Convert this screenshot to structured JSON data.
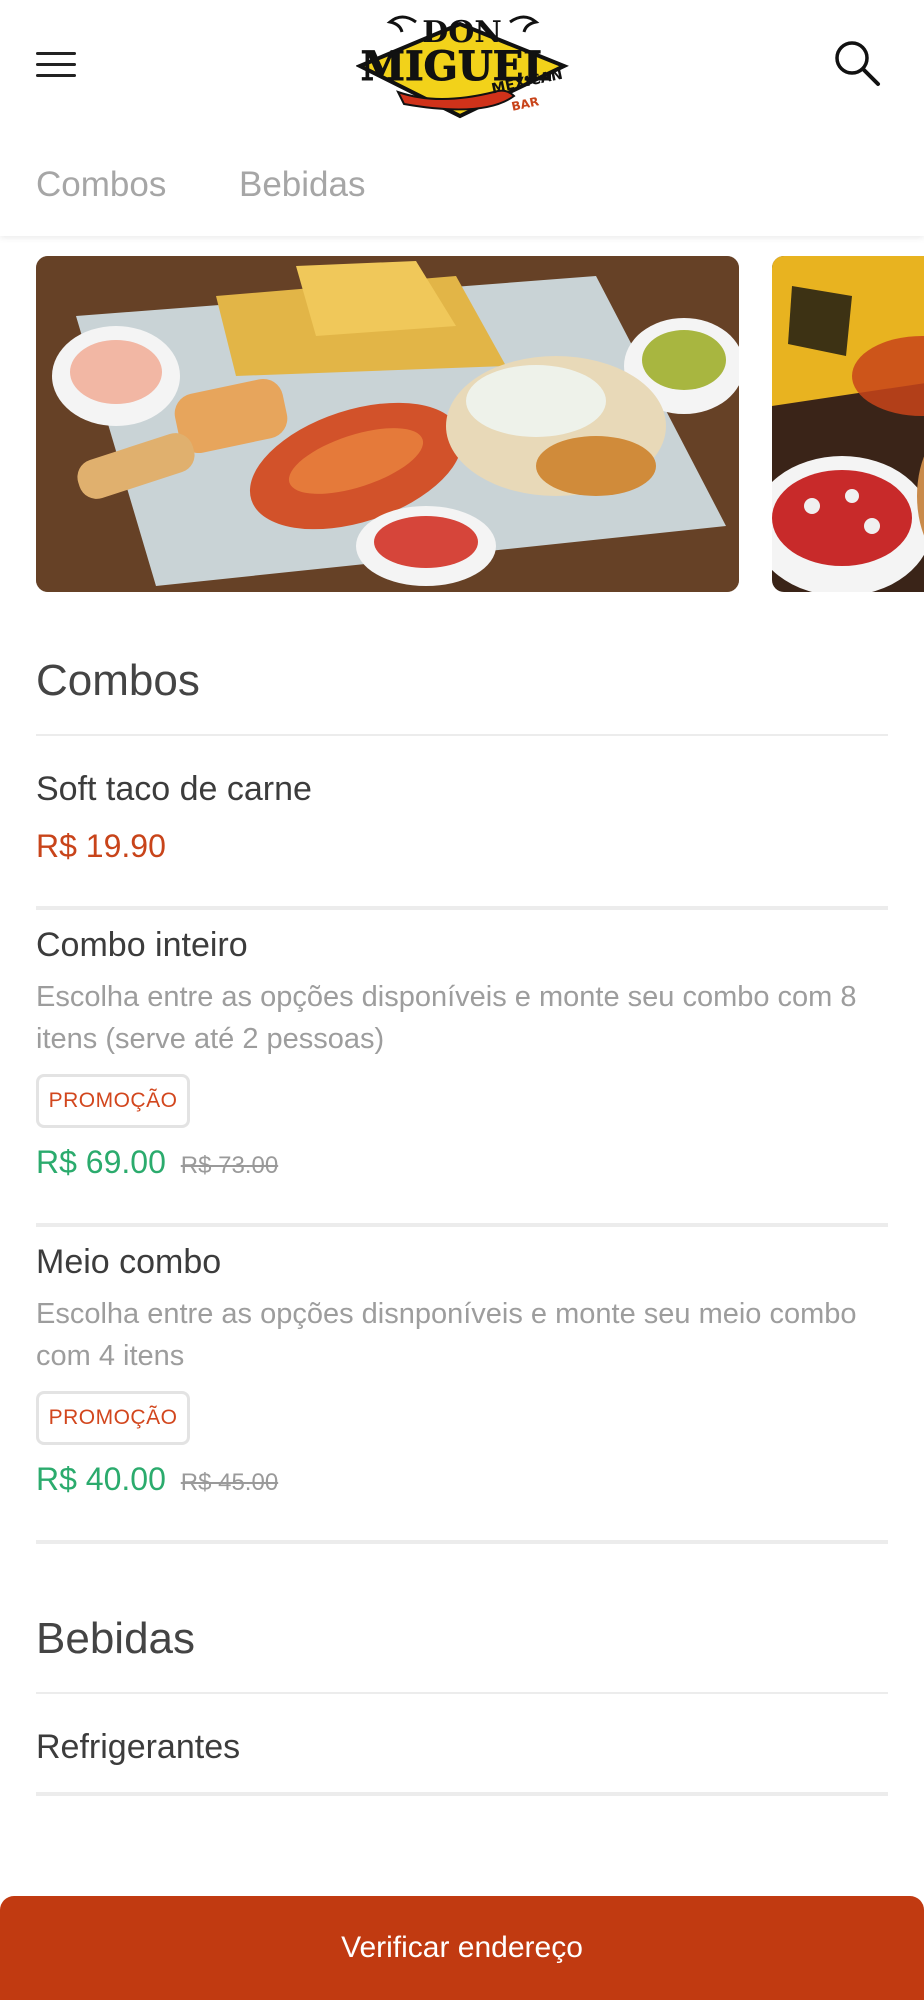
{
  "header": {
    "menu_icon": "hamburger-menu-icon",
    "logo_alt": "Don Miguel Mexican Bar",
    "logo_text": {
      "line1": "DON",
      "line2": "MIGUEL",
      "line3": "MEXICAN",
      "line4": "BAR"
    },
    "search_icon": "search-icon"
  },
  "tabs": [
    {
      "label": "Combos"
    },
    {
      "label": "Bebidas"
    }
  ],
  "sections": {
    "combos": {
      "title": "Combos",
      "items": [
        {
          "name": "Soft taco de carne",
          "price": "R$ 19.90"
        },
        {
          "name": "Combo inteiro",
          "description": "Escolha entre as opções disponíveis e monte seu combo com 8 itens (serve até 2 pessoas)",
          "badge": "PROMOÇÃO",
          "price": "R$ 69.00",
          "old_price": "R$ 73.00"
        },
        {
          "name": "Meio combo",
          "description": "Escolha entre as opções disnponíveis e monte seu meio combo com 4 itens",
          "badge": "PROMOÇÃO",
          "price": "R$ 40.00",
          "old_price": "R$ 45.00"
        }
      ]
    },
    "bebidas": {
      "title": "Bebidas",
      "items": [
        {
          "name": "Refrigerantes"
        }
      ]
    }
  },
  "footer": {
    "button_label": "Verificar endereço"
  },
  "colors": {
    "accent": "#c13a11",
    "price_red": "#c8441a",
    "price_green": "#2bab6d",
    "badge_text": "#d2461d"
  }
}
